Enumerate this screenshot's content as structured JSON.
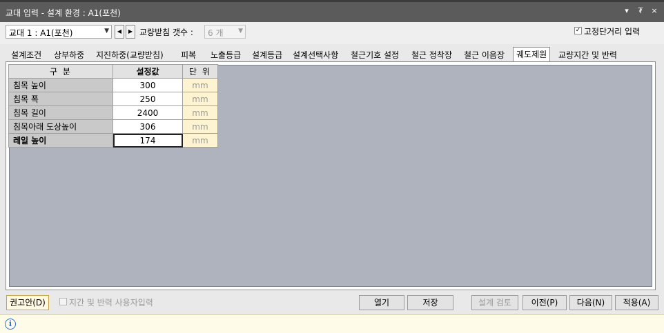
{
  "window": {
    "title": "교대 입력 - 설계 환경 : A1(포천)",
    "controls": [
      "▾",
      "₮",
      "×"
    ]
  },
  "toolbar": {
    "abutment_select": "교대 1 : A1(포천)",
    "nav_prev": "◀",
    "nav_next": "▶",
    "bearing_count_label": "교량받침 갯수 :",
    "bearing_count_value": "6 개",
    "fixed_span_checked": "✓",
    "fixed_span_label": "고정단거리 입력"
  },
  "tabs": [
    {
      "label": "설계조건"
    },
    {
      "label": "상부하중"
    },
    {
      "label": "지진하중(교량받침)"
    },
    {
      "label": "피복"
    },
    {
      "label": "노출등급"
    },
    {
      "label": "설계등급"
    },
    {
      "label": "설계선택사항"
    },
    {
      "label": "철근기호 설정"
    },
    {
      "label": "철근 정착장"
    },
    {
      "label": "철근 이음장"
    },
    {
      "label": "궤도제원",
      "active": true
    },
    {
      "label": "교량지간 및 반력"
    }
  ],
  "grid": {
    "headers": {
      "name": "구 분",
      "value": "설정값",
      "unit": "단 위"
    },
    "rows": [
      {
        "name": "침목 높이",
        "value": "300",
        "unit": "mm"
      },
      {
        "name": "침목 폭",
        "value": "250",
        "unit": "mm"
      },
      {
        "name": "침목 길이",
        "value": "2400",
        "unit": "mm"
      },
      {
        "name": "침목아래 도상높이",
        "value": "306",
        "unit": "mm"
      },
      {
        "name": "레일 높이",
        "value": "174",
        "unit": "mm"
      }
    ]
  },
  "bottom": {
    "recommend_button": "권고안(D)",
    "user_input_label": "지간 및 반력 사용자입력",
    "open_button": "열기",
    "save_button": "저장",
    "design_check_button": "설계 검토",
    "prev_button": "이전(P)",
    "next_button": "다음(N)",
    "apply_button": "적용(A)"
  },
  "status": {
    "icon": "info-icon"
  }
}
